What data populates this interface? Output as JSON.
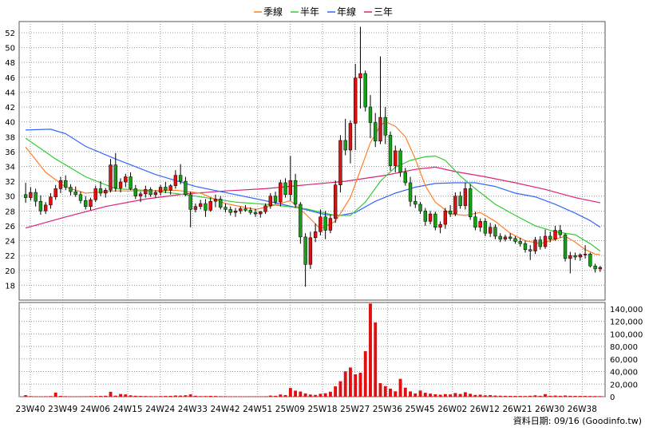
{
  "chart_data": {
    "type": "candlestick",
    "legend": {
      "placement": "top-center",
      "items": [
        {
          "name": "季線",
          "color": "#ff7f27"
        },
        {
          "name": "半年",
          "color": "#33cc33"
        },
        {
          "name": "年線",
          "color": "#3366ff"
        },
        {
          "name": "三年",
          "color": "#dd2277"
        }
      ]
    },
    "colors": {
      "up": "#e01010",
      "down": "#16a016",
      "volume": "#e01010",
      "grid": "#999999"
    },
    "price_axis": {
      "min": 16,
      "max": 53.5,
      "ticks": [
        18,
        20,
        22,
        24,
        26,
        28,
        30,
        32,
        34,
        36,
        38,
        40,
        42,
        44,
        46,
        48,
        50,
        52
      ]
    },
    "volume_axis": {
      "min": 0,
      "max": 150000,
      "ticks": [
        0,
        20000,
        40000,
        60000,
        80000,
        100000,
        120000,
        140000
      ],
      "tick_labels": [
        "0",
        "20,000",
        "40,000",
        "60,000",
        "80,000",
        "100,000",
        "120,000",
        "140,000"
      ]
    },
    "x_labels": [
      "23W40",
      "23W49",
      "24W06",
      "24W15",
      "24W24",
      "24W33",
      "24W42",
      "24W51",
      "25W09",
      "25W18",
      "25W27",
      "25W36",
      "25W45",
      "26W02",
      "26W12",
      "26W21",
      "26W30",
      "26W38"
    ],
    "grid": true,
    "footer": "資料日期: 09/16 (Goodinfo.tw)",
    "candles": [
      [
        30.2,
        31.8,
        29.1,
        29.8
      ],
      [
        29.8,
        31.2,
        29.4,
        30.5
      ],
      [
        30.5,
        31.0,
        28.6,
        29.3
      ],
      [
        29.3,
        30.1,
        27.5,
        28.0
      ],
      [
        28.0,
        29.2,
        27.6,
        28.8
      ],
      [
        28.8,
        30.4,
        28.3,
        29.9
      ],
      [
        29.9,
        31.5,
        29.5,
        31.0
      ],
      [
        31.0,
        32.6,
        30.4,
        32.1
      ],
      [
        32.1,
        32.8,
        30.8,
        31.2
      ],
      [
        31.2,
        31.6,
        30.1,
        30.6
      ],
      [
        30.6,
        31.3,
        29.9,
        30.2
      ],
      [
        30.2,
        30.6,
        29.0,
        29.4
      ],
      [
        29.4,
        30.0,
        28.2,
        28.6
      ],
      [
        28.6,
        29.8,
        28.1,
        29.5
      ],
      [
        29.5,
        31.4,
        29.2,
        31.0
      ],
      [
        31.0,
        32.0,
        30.0,
        30.4
      ],
      [
        30.4,
        31.1,
        29.8,
        30.8
      ],
      [
        30.8,
        35.0,
        30.5,
        34.2
      ],
      [
        34.2,
        35.8,
        30.6,
        31.1
      ],
      [
        31.1,
        32.4,
        30.5,
        31.9
      ],
      [
        31.9,
        33.0,
        31.2,
        32.6
      ],
      [
        32.6,
        33.2,
        30.8,
        31.0
      ],
      [
        31.0,
        31.5,
        29.6,
        30.0
      ],
      [
        30.0,
        30.6,
        29.2,
        30.3
      ],
      [
        30.3,
        31.4,
        29.8,
        30.9
      ],
      [
        30.9,
        31.2,
        29.9,
        30.2
      ],
      [
        30.2,
        30.8,
        29.8,
        30.5
      ],
      [
        30.5,
        31.5,
        30.1,
        31.2
      ],
      [
        31.2,
        31.9,
        30.4,
        30.8
      ],
      [
        30.8,
        31.6,
        30.2,
        31.4
      ],
      [
        31.4,
        33.5,
        31.0,
        32.8
      ],
      [
        32.8,
        34.3,
        31.6,
        32.0
      ],
      [
        32.0,
        32.6,
        30.0,
        30.2
      ],
      [
        30.2,
        30.6,
        25.8,
        28.2
      ],
      [
        28.2,
        29.0,
        27.8,
        28.6
      ],
      [
        28.6,
        29.5,
        28.2,
        29.0
      ],
      [
        29.0,
        29.6,
        27.2,
        28.1
      ],
      [
        28.1,
        29.8,
        27.9,
        29.3
      ],
      [
        29.3,
        30.2,
        28.5,
        29.6
      ],
      [
        29.6,
        30.0,
        28.2,
        28.5
      ],
      [
        28.5,
        29.0,
        27.8,
        28.2
      ],
      [
        28.2,
        28.6,
        27.4,
        27.8
      ],
      [
        27.8,
        28.4,
        27.2,
        28.0
      ],
      [
        28.0,
        28.6,
        27.6,
        28.3
      ],
      [
        28.3,
        28.8,
        27.9,
        28.1
      ],
      [
        28.1,
        28.5,
        27.5,
        27.8
      ],
      [
        27.8,
        28.3,
        27.2,
        27.6
      ],
      [
        27.6,
        28.0,
        27.1,
        27.9
      ],
      [
        27.9,
        29.0,
        27.6,
        28.7
      ],
      [
        28.7,
        30.4,
        28.3,
        30.0
      ],
      [
        30.0,
        30.6,
        28.9,
        29.2
      ],
      [
        29.2,
        32.2,
        28.6,
        31.8
      ],
      [
        31.8,
        32.4,
        29.8,
        30.2
      ],
      [
        30.2,
        35.4,
        29.4,
        32.1
      ],
      [
        32.1,
        33.0,
        28.4,
        28.9
      ],
      [
        28.9,
        29.2,
        23.6,
        24.5
      ],
      [
        24.5,
        25.0,
        17.8,
        20.8
      ],
      [
        20.8,
        25.2,
        20.2,
        24.4
      ],
      [
        24.4,
        26.3,
        23.8,
        25.2
      ],
      [
        25.2,
        28.2,
        24.7,
        27.2
      ],
      [
        27.2,
        28.0,
        24.2,
        25.4
      ],
      [
        25.4,
        27.5,
        25.0,
        27.0
      ],
      [
        27.0,
        32.1,
        26.4,
        31.5
      ],
      [
        31.5,
        38.2,
        30.5,
        37.5
      ],
      [
        37.5,
        40.4,
        35.5,
        36.2
      ],
      [
        36.2,
        40.2,
        34.4,
        39.8
      ],
      [
        39.8,
        47.8,
        36.2,
        45.9
      ],
      [
        45.9,
        52.8,
        41.8,
        46.5
      ],
      [
        46.5,
        46.9,
        41.4,
        42.0
      ],
      [
        42.0,
        43.6,
        37.8,
        39.9
      ],
      [
        39.9,
        41.2,
        36.6,
        37.4
      ],
      [
        37.4,
        48.8,
        37.0,
        40.6
      ],
      [
        40.6,
        42.0,
        37.0,
        38.2
      ],
      [
        38.2,
        38.7,
        33.4,
        34.1
      ],
      [
        34.1,
        36.8,
        33.2,
        36.1
      ],
      [
        36.1,
        36.4,
        32.6,
        33.2
      ],
      [
        33.2,
        33.8,
        31.4,
        31.8
      ],
      [
        31.8,
        32.6,
        28.6,
        29.3
      ],
      [
        29.3,
        30.1,
        28.4,
        28.9
      ],
      [
        28.9,
        29.2,
        27.6,
        28.0
      ],
      [
        28.0,
        28.4,
        26.0,
        26.6
      ],
      [
        26.6,
        28.0,
        26.2,
        27.6
      ],
      [
        27.6,
        27.9,
        25.4,
        25.8
      ],
      [
        25.8,
        26.6,
        25.0,
        26.2
      ],
      [
        26.2,
        28.4,
        25.6,
        28.0
      ],
      [
        28.0,
        28.8,
        27.2,
        27.6
      ],
      [
        27.6,
        30.5,
        27.3,
        30.0
      ],
      [
        30.0,
        30.6,
        28.3,
        28.7
      ],
      [
        28.7,
        31.8,
        28.2,
        31.0
      ],
      [
        31.0,
        31.6,
        26.8,
        27.2
      ],
      [
        27.2,
        27.9,
        25.4,
        25.8
      ],
      [
        25.8,
        27.0,
        25.2,
        26.6
      ],
      [
        26.6,
        27.0,
        24.6,
        25.0
      ],
      [
        25.0,
        26.4,
        24.5,
        25.8
      ],
      [
        25.8,
        26.2,
        24.2,
        24.6
      ],
      [
        24.6,
        25.0,
        23.8,
        24.2
      ],
      [
        24.2,
        24.8,
        23.9,
        24.5
      ],
      [
        24.5,
        25.0,
        24.0,
        24.3
      ],
      [
        24.3,
        24.6,
        23.6,
        23.9
      ],
      [
        23.9,
        24.4,
        23.2,
        23.6
      ],
      [
        23.6,
        24.0,
        22.4,
        22.8
      ],
      [
        22.8,
        23.4,
        21.4,
        22.6
      ],
      [
        22.6,
        24.5,
        22.2,
        24.1
      ],
      [
        24.1,
        24.6,
        22.8,
        23.2
      ],
      [
        23.2,
        25.5,
        22.9,
        24.6
      ],
      [
        24.6,
        25.2,
        23.8,
        24.2
      ],
      [
        24.2,
        26.0,
        24.0,
        25.4
      ],
      [
        25.4,
        26.1,
        24.4,
        24.8
      ],
      [
        24.8,
        25.0,
        21.2,
        21.6
      ],
      [
        21.6,
        22.5,
        19.6,
        22.0
      ],
      [
        22.0,
        22.4,
        21.4,
        21.8
      ],
      [
        21.8,
        22.3,
        21.3,
        22.1
      ],
      [
        22.1,
        23.4,
        21.6,
        22.2
      ],
      [
        22.2,
        22.4,
        20.4,
        20.6
      ],
      [
        20.6,
        20.9,
        19.7,
        20.2
      ],
      [
        20.2,
        20.6,
        19.8,
        20.4
      ]
    ],
    "volume": [
      2400,
      800,
      600,
      500,
      700,
      900,
      6500,
      1200,
      800,
      600,
      500,
      600,
      700,
      900,
      1000,
      1200,
      1500,
      7800,
      1600,
      4200,
      3600,
      2200,
      1500,
      1200,
      1100,
      900,
      800,
      1000,
      1200,
      1300,
      1900,
      1800,
      2300,
      3600,
      1500,
      900,
      1000,
      1300,
      1100,
      800,
      700,
      600,
      500,
      600,
      500,
      500,
      500,
      600,
      700,
      1800,
      1400,
      3500,
      2600,
      13800,
      9600,
      8200,
      5200,
      3400,
      2800,
      4600,
      5400,
      7900,
      16400,
      24600,
      40300,
      46500,
      35700,
      38200,
      72400,
      148300,
      118200,
      21500,
      16800,
      12800,
      8600,
      28400,
      14300,
      8400,
      5200,
      9800,
      6200,
      4800,
      3800,
      3200,
      4100,
      3600,
      5800,
      4300,
      7100,
      4600,
      2800,
      3200,
      2200,
      2600,
      1800,
      1600,
      1400,
      1300,
      1200,
      1200,
      1100,
      1500,
      2200,
      1400,
      4000,
      1500,
      1800,
      1400,
      1900,
      1400,
      1300,
      1200,
      1200,
      1100,
      1000,
      900
    ],
    "ma_seasonal": [
      [
        0,
        36.6
      ],
      [
        4,
        33.2
      ],
      [
        8,
        31.2
      ],
      [
        12,
        30.4
      ],
      [
        18,
        30.7
      ],
      [
        24,
        30.7
      ],
      [
        30,
        30.8
      ],
      [
        35,
        30.4
      ],
      [
        40,
        29.0
      ],
      [
        46,
        28.2
      ],
      [
        50,
        28.8
      ],
      [
        53,
        29.4
      ],
      [
        56,
        27.6
      ],
      [
        59,
        25.6
      ],
      [
        62,
        26.6
      ],
      [
        65,
        29.8
      ],
      [
        67,
        33.5
      ],
      [
        69,
        37.2
      ],
      [
        71,
        39.5
      ],
      [
        72,
        40.0
      ],
      [
        74,
        39.4
      ],
      [
        76,
        38.0
      ],
      [
        78,
        35.0
      ],
      [
        80,
        31.4
      ],
      [
        82,
        29.2
      ],
      [
        85,
        27.6
      ],
      [
        88,
        27.4
      ],
      [
        91,
        27.8
      ],
      [
        94,
        26.6
      ],
      [
        97,
        25.0
      ],
      [
        100,
        24.0
      ],
      [
        103,
        23.6
      ],
      [
        106,
        24.2
      ],
      [
        108,
        24.6
      ],
      [
        110,
        23.8
      ],
      [
        112,
        22.8
      ],
      [
        114,
        22.2
      ],
      [
        115,
        22.1
      ]
    ],
    "ma_half_year": [
      [
        0,
        37.8
      ],
      [
        6,
        35.0
      ],
      [
        12,
        32.6
      ],
      [
        18,
        31.0
      ],
      [
        26,
        30.7
      ],
      [
        34,
        30.0
      ],
      [
        42,
        29.2
      ],
      [
        50,
        28.8
      ],
      [
        56,
        28.3
      ],
      [
        62,
        27.4
      ],
      [
        65,
        27.4
      ],
      [
        68,
        29.2
      ],
      [
        71,
        32.0
      ],
      [
        74,
        33.9
      ],
      [
        77,
        34.8
      ],
      [
        80,
        35.3
      ],
      [
        82,
        35.4
      ],
      [
        84,
        34.8
      ],
      [
        87,
        32.7
      ],
      [
        90,
        31.0
      ],
      [
        94,
        28.9
      ],
      [
        98,
        27.4
      ],
      [
        102,
        26.0
      ],
      [
        106,
        25.2
      ],
      [
        110,
        24.8
      ],
      [
        113,
        23.6
      ],
      [
        115,
        22.6
      ]
    ],
    "ma_year": [
      [
        0,
        38.9
      ],
      [
        5,
        39.0
      ],
      [
        8,
        38.4
      ],
      [
        12,
        36.7
      ],
      [
        18,
        35.0
      ],
      [
        26,
        32.9
      ],
      [
        34,
        31.3
      ],
      [
        42,
        30.2
      ],
      [
        50,
        29.1
      ],
      [
        56,
        28.2
      ],
      [
        60,
        27.5
      ],
      [
        63,
        27.4
      ],
      [
        66,
        27.8
      ],
      [
        70,
        29.3
      ],
      [
        74,
        30.4
      ],
      [
        78,
        31.2
      ],
      [
        82,
        31.7
      ],
      [
        86,
        31.8
      ],
      [
        90,
        31.8
      ],
      [
        94,
        31.3
      ],
      [
        98,
        30.4
      ],
      [
        102,
        29.9
      ],
      [
        106,
        28.9
      ],
      [
        110,
        27.7
      ],
      [
        113,
        26.7
      ],
      [
        115,
        25.8
      ]
    ],
    "ma_three_year": [
      [
        0,
        25.7
      ],
      [
        8,
        27.2
      ],
      [
        16,
        28.6
      ],
      [
        24,
        29.6
      ],
      [
        32,
        30.3
      ],
      [
        40,
        30.7
      ],
      [
        48,
        31.0
      ],
      [
        56,
        31.5
      ],
      [
        64,
        32.0
      ],
      [
        72,
        32.8
      ],
      [
        78,
        33.6
      ],
      [
        82,
        33.9
      ],
      [
        86,
        33.3
      ],
      [
        92,
        32.6
      ],
      [
        98,
        31.8
      ],
      [
        104,
        30.9
      ],
      [
        110,
        29.8
      ],
      [
        115,
        29.1
      ]
    ]
  }
}
